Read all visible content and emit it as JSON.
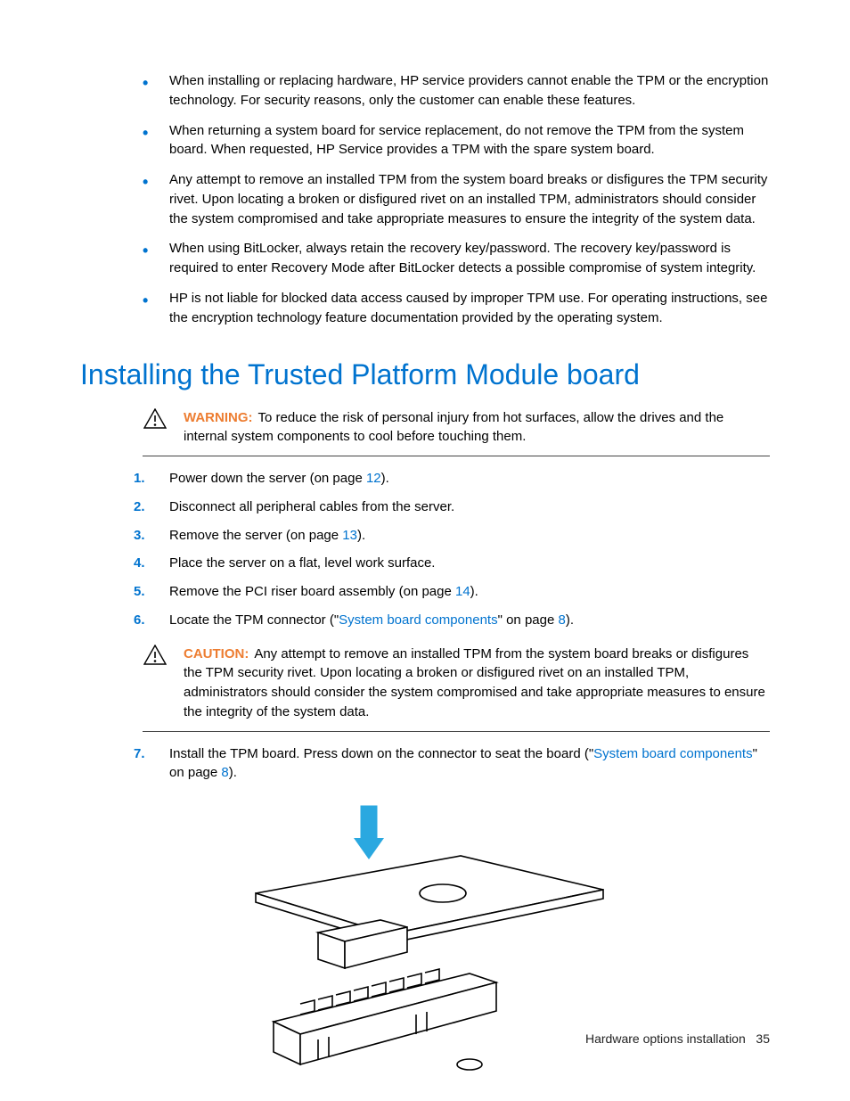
{
  "bullets": [
    "When installing or replacing hardware, HP service providers cannot enable the TPM or the encryption technology. For security reasons, only the customer can enable these features.",
    "When returning a system board for service replacement, do not remove the TPM from the system board. When requested, HP Service provides a TPM with the spare system board.",
    "Any attempt to remove an installed TPM from the system board breaks or disfigures the TPM security rivet. Upon locating a broken or disfigured rivet on an installed TPM, administrators should consider the system compromised and take appropriate measures to ensure the integrity of the system data.",
    "When using BitLocker, always retain the recovery key/password. The recovery key/password is required to enter Recovery Mode after BitLocker detects a possible compromise of system integrity.",
    "HP is not liable for blocked data access caused by improper TPM use. For operating instructions, see the encryption technology feature documentation provided by the operating system."
  ],
  "heading": "Installing the Trusted Platform Module board",
  "warning": {
    "label": "WARNING:",
    "text": "To reduce the risk of personal injury from hot surfaces, allow the drives and the internal system components to cool before touching them."
  },
  "steps": {
    "s1a": "Power down the server (on page ",
    "s1_link": "12",
    "s1b": ").",
    "s2": "Disconnect all peripheral cables from the server.",
    "s3a": "Remove the server (on page ",
    "s3_link": "13",
    "s3b": ").",
    "s4": "Place the server on a flat, level work surface.",
    "s5a": "Remove the PCI riser board assembly (on page ",
    "s5_link": "14",
    "s5b": ").",
    "s6a": "Locate the TPM connector (\"",
    "s6_link": "System board components",
    "s6b": "\" on page ",
    "s6_page": "8",
    "s6c": ").",
    "s7a": "Install the TPM board. Press down on the connector to seat the board (\"",
    "s7_link": "System board components",
    "s7b": "\" on page ",
    "s7_page": "8",
    "s7c": ")."
  },
  "caution": {
    "label": "CAUTION:",
    "text": "Any attempt to remove an installed TPM from the system board breaks or disfigures the TPM security rivet. Upon locating a broken or disfigured rivet on an installed TPM, administrators should consider the system compromised and take appropriate measures to ensure the integrity of the system data."
  },
  "nums": {
    "n1": "1.",
    "n2": "2.",
    "n3": "3.",
    "n4": "4.",
    "n5": "5.",
    "n6": "6.",
    "n7": "7."
  },
  "footer": {
    "section": "Hardware options installation",
    "page": "35"
  }
}
